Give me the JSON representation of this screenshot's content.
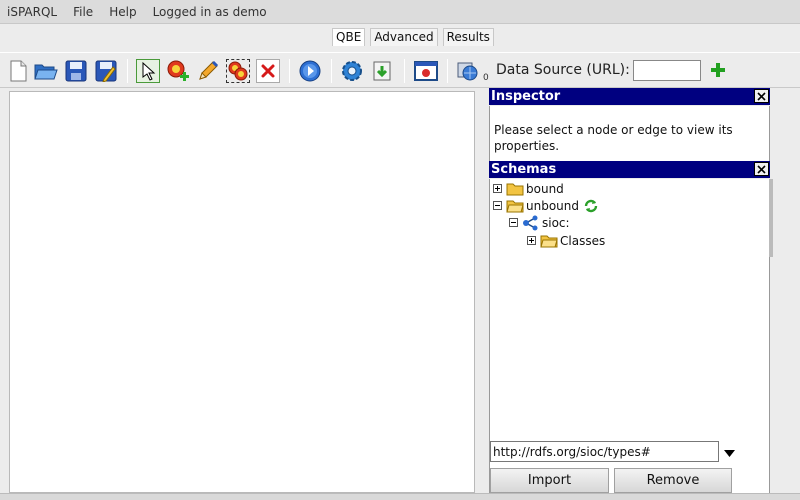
{
  "menubar": {
    "items": [
      "iSPARQL",
      "File",
      "Help",
      "Logged in as demo"
    ]
  },
  "tabs": [
    "QBE",
    "Advanced",
    "Results"
  ],
  "toolbar": {
    "icons": [
      "new-file-icon",
      "open-folder-icon",
      "save-icon",
      "save-as-icon",
      "pointer-icon",
      "add-node-icon",
      "pencil-icon",
      "group-nodes-icon",
      "delete-icon",
      "run-icon",
      "settings-icon",
      "import-icon",
      "dialog-icon",
      "datasource-icon"
    ],
    "datasource_badge": "0",
    "datasource_label": "Data Source (URL):",
    "datasource_value": ""
  },
  "inspector": {
    "title": "Inspector",
    "message": "Please select a node or edge to view its properties."
  },
  "schemas": {
    "title": "Schemas",
    "tree": {
      "bound": "bound",
      "unbound": "unbound",
      "sioc": "sioc:",
      "classes": "Classes"
    },
    "url": "http://rdfs.org/sioc/types#",
    "import_label": "Import",
    "remove_label": "Remove"
  },
  "colors": {
    "panel_header": "#000080",
    "folder": "#f2c442",
    "accent_green": "#22a020"
  }
}
